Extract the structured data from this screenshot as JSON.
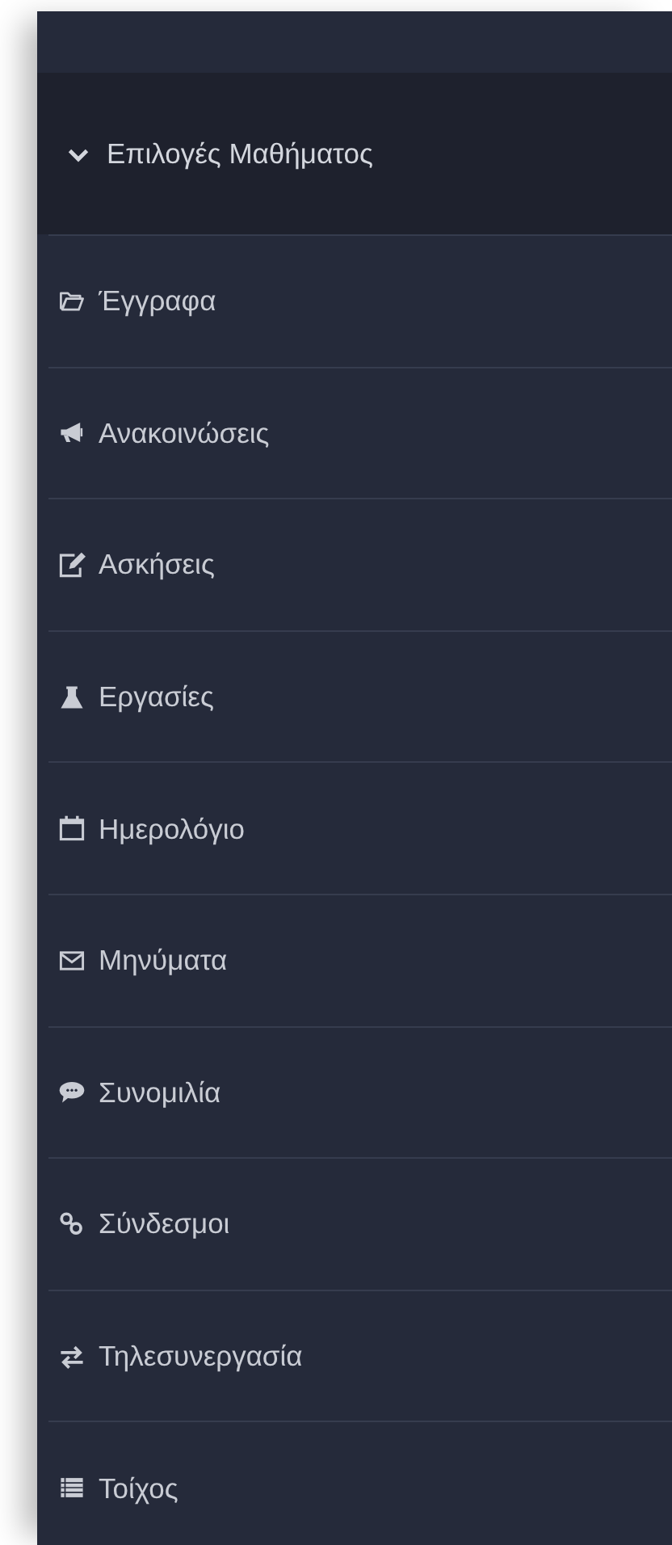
{
  "menu": {
    "title": "Επιλογές Μαθήματος",
    "expanded": true,
    "items": [
      {
        "label": "Έγγραφα"
      },
      {
        "label": "Ανακοινώσεις"
      },
      {
        "label": "Ασκήσεις"
      },
      {
        "label": "Εργασίες"
      },
      {
        "label": "Ημερολόγιο"
      },
      {
        "label": "Μηνύματα"
      },
      {
        "label": "Συνομιλία"
      },
      {
        "label": "Σύνδεσμοι"
      },
      {
        "label": "Τηλεσυνεργασία"
      },
      {
        "label": "Τοίχος"
      }
    ]
  }
}
